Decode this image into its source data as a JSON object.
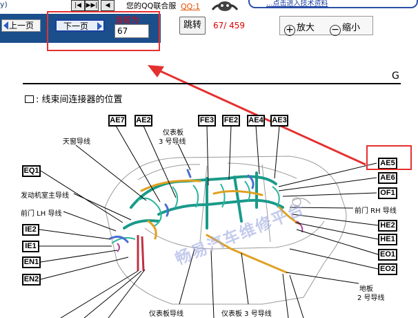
{
  "toolbar": {
    "left_text": "y)",
    "buttons": [
      "|◀",
      "▶▶|",
      "◀"
    ],
    "marquee": "您的QQ联合服",
    "qq_link": "QQ:1",
    "site_link": "...点击进入技术资料"
  },
  "nav": {
    "prev_label": "上一页",
    "next_label": "下一页",
    "current_label": "当前为",
    "current_page": "67",
    "jump_label": "跳转",
    "page_count": "67/ 459",
    "zoom_in_label": "放大",
    "zoom_out_label": "缩小",
    "zoom_in_glyph": "+",
    "zoom_out_glyph": "−"
  },
  "page": {
    "letter": "G",
    "section_title": ": 线束间连接器的位置"
  },
  "connectors": {
    "ae7": "AE7",
    "ae2": "AE2",
    "fe3": "FE3",
    "fe2": "FE2",
    "ae4": "AE4",
    "ae3": "AE3",
    "eq1": "EQ1",
    "ae5": "AE5",
    "ae6": "AE6",
    "of1": "OF1",
    "ie2": "IE2",
    "ie1": "IE1",
    "en1": "EN1",
    "en2": "EN2",
    "he2": "HE2",
    "he1": "HE1",
    "eo1": "EO1",
    "eo2": "EO2"
  },
  "labels": {
    "sunroof": "天窗导线",
    "ip_wire_1": "仪表板",
    "ip_wire_2": "3 号导线",
    "engine_main": "发动机室主导线",
    "front_door_lh": "前门 LH 导线",
    "front_door_rh": "前门 RH 导线",
    "floor_1": "地板",
    "floor_2": "2 号导线",
    "ip_bottom": "仪表板导线",
    "ip3_bottom": "仪表板 3 号导线"
  },
  "watermark": "畅易汽车维修平台",
  "colors": {
    "nav_blue": "#1b4f8c",
    "annotation_red": "#e53030",
    "wire_teal": "#1a9a8a",
    "wire_orange": "#e0a020",
    "page_count_red": "#e00000"
  }
}
